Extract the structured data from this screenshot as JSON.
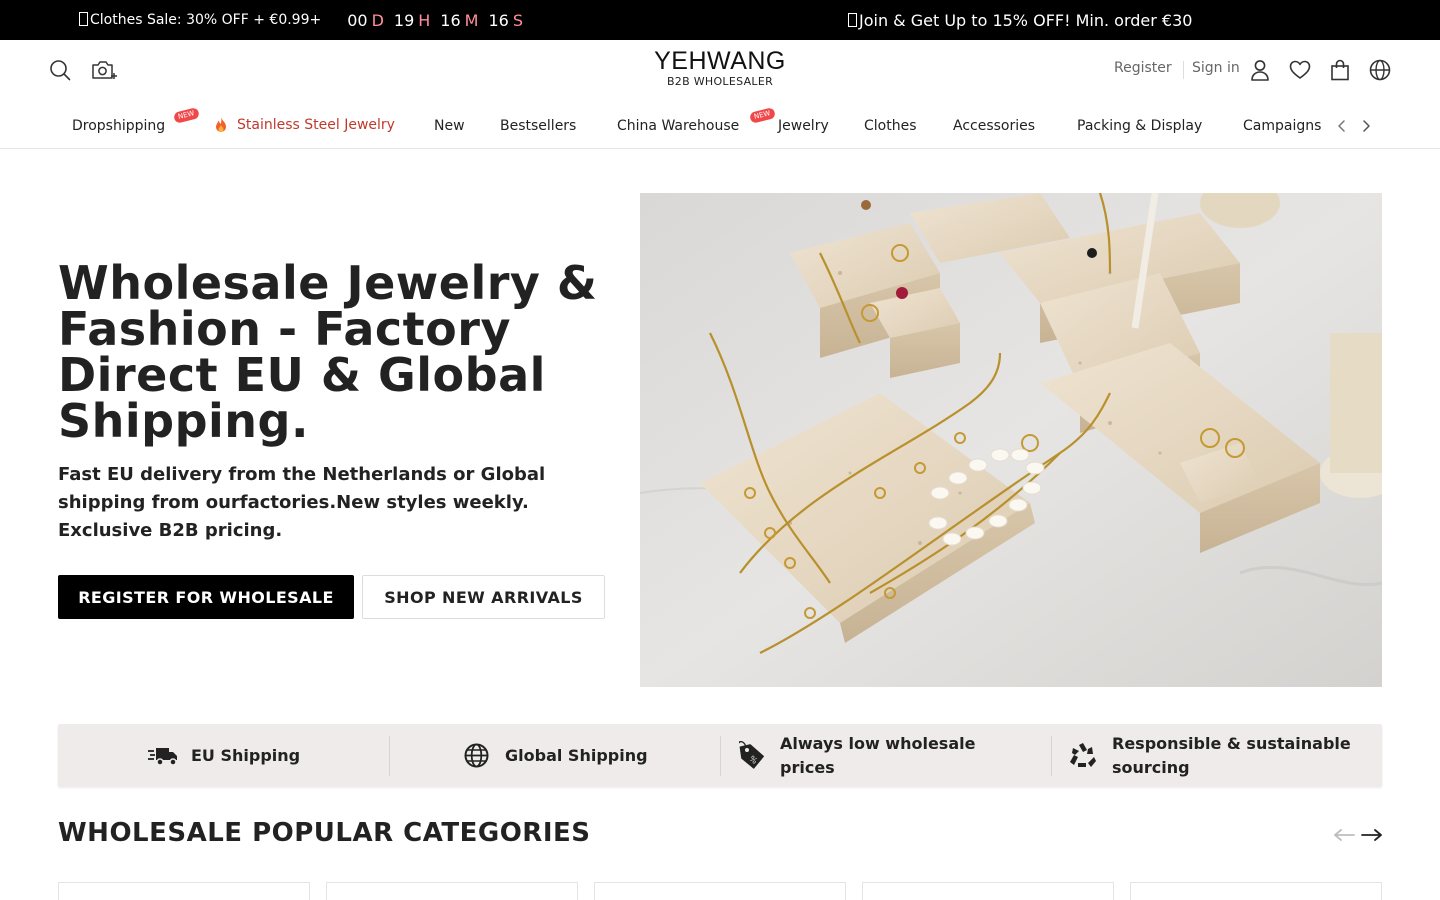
{
  "promo": {
    "sale_text": "Clothes Sale: 30% OFF + €0.99+",
    "countdown": [
      {
        "value": "00",
        "unit": "D"
      },
      {
        "value": "19",
        "unit": "H"
      },
      {
        "value": "16",
        "unit": "M"
      },
      {
        "value": "16",
        "unit": "S"
      }
    ],
    "join_text": "Join & Get Up to 15% OFF! Min. order €30"
  },
  "header": {
    "brand": "YEHWANG",
    "tagline": "B2B WHOLESALER",
    "register": "Register",
    "sign_in": "Sign in",
    "icons": [
      "search-icon",
      "camera-search-icon",
      "user-icon",
      "heart-icon",
      "bag-icon",
      "globe-icon"
    ]
  },
  "nav": {
    "items": [
      {
        "label": "Dropshipping",
        "badge": "NEW"
      },
      {
        "label": "Stainless Steel Jewelry",
        "hot": true
      },
      {
        "label": "New"
      },
      {
        "label": "Bestsellers"
      },
      {
        "label": "China Warehouse",
        "badge": "NEW"
      },
      {
        "label": "Jewelry"
      },
      {
        "label": "Clothes"
      },
      {
        "label": "Accessories"
      },
      {
        "label": "Packing & Display"
      },
      {
        "label": "Campaigns"
      }
    ]
  },
  "hero": {
    "title": "Wholesale Jewelry & Fashion - Factory Direct EU & Global Shipping.",
    "subtitle": "Fast EU delivery from the Netherlands or Global shipping from ourfactories.New styles weekly. Exclusive B2B pricing.",
    "primary_button": "REGISTER FOR WHOLESALE",
    "secondary_button": "SHOP NEW ARRIVALS"
  },
  "features": [
    {
      "label": "EU Shipping",
      "icon": "truck-icon"
    },
    {
      "label": "Global Shipping",
      "icon": "globe-icon"
    },
    {
      "label": "Always low wholesale prices",
      "icon": "price-tag-icon"
    },
    {
      "label": "Responsible & sustainable sourcing",
      "icon": "recycle-icon"
    }
  ],
  "categories": {
    "title": "WHOLESALE POPULAR CATEGORIES"
  },
  "colors": {
    "promo_bg": "#000000",
    "countdown_unit": "#ff8f9a",
    "hot_link": "#c0392b",
    "badge": "#f04848",
    "feature_bg": "#efebea"
  }
}
